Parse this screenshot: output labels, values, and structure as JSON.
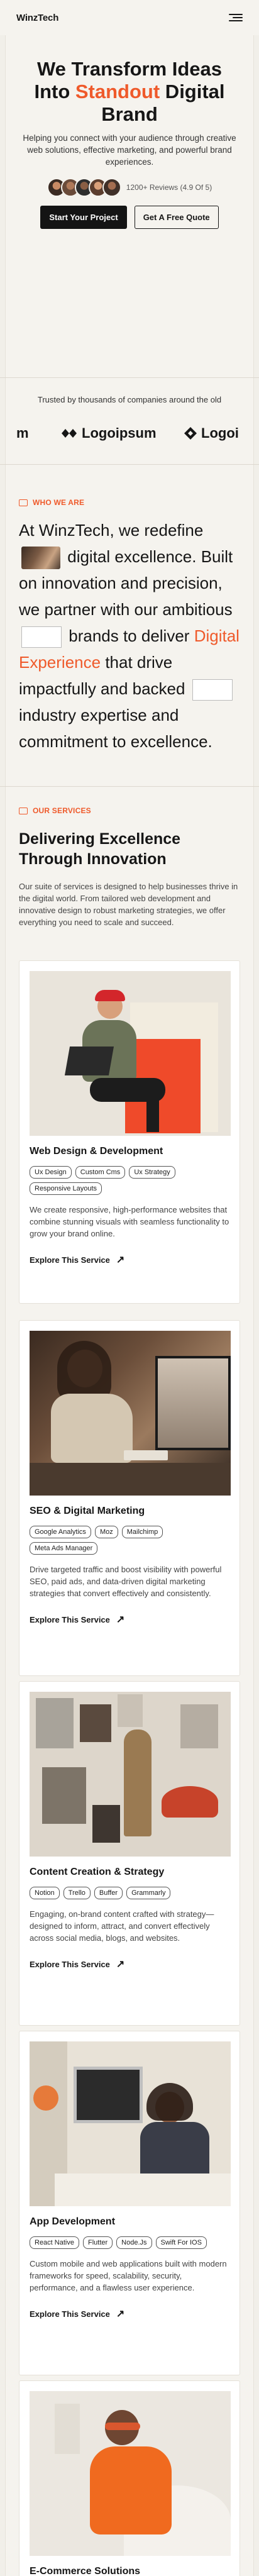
{
  "nav": {
    "brand": "WinzTech",
    "brand_mark": "W",
    "menu_icon": "hamburger-menu-icon"
  },
  "hero": {
    "title_line1": "We Transform Ideas",
    "title_line2_pre": "Into ",
    "title_accent": "Standout",
    "title_line2_post": " Digital",
    "title_line3": "Brand",
    "subtitle": "Helping you connect with your audience through creative web solutions, effective marketing, and powerful brand experiences.",
    "reviews": "1200+ Reviews (4.9 Of 5)",
    "primary_cta": "Start Your Project",
    "secondary_cta": "Get A Free Quote"
  },
  "trusted": {
    "text": "Trusted by thousands of companies around the old",
    "logos": [
      "m",
      "Logoipsum",
      "Logoi"
    ]
  },
  "about": {
    "eyebrow": "WHO WE ARE",
    "p1": "At WinzTech, we redefine",
    "p2": "digital excellence. Built on innovation and precision, we partner with our ambitious",
    "p3": "brands to deliver",
    "accent": "Digital Experience",
    "p4": "that drive impactfully and backed",
    "p5": "industry expertise and commitment to excellence."
  },
  "services": {
    "eyebrow": "OUR SERVICES",
    "title": "Delivering Excellence Through Innovation",
    "description": "Our suite of services is designed to help businesses thrive in the digital world. From tailored web development and innovative design to robust marketing strategies, we offer everything you need to scale and succeed.",
    "explore_label": "Explore This Service",
    "cards": [
      {
        "title": "Web Design & Development",
        "tags": [
          "Ux Design",
          "Custom Cms",
          "Ux Strategy",
          "Responsive Layouts"
        ],
        "desc": "We create responsive, high-performance websites that combine stunning visuals with seamless functionality to grow your brand online."
      },
      {
        "title": "SEO & Digital Marketing",
        "tags": [
          "Google Analytics",
          "Moz",
          "Mailchimp",
          "Meta Ads Manager"
        ],
        "desc": "Drive targeted traffic and boost visibility with powerful SEO, paid ads, and data-driven digital marketing strategies that convert effectively and consistently."
      },
      {
        "title": "Content Creation & Strategy",
        "tags": [
          "Notion",
          "Trello",
          "Buffer",
          "Grammarly"
        ],
        "desc": "Engaging, on-brand content crafted with strategy—designed to inform, attract, and convert effectively across social media, blogs, and websites."
      },
      {
        "title": "App Development",
        "tags": [
          "React Native",
          "Flutter",
          "Node.Js",
          "Swift For IOS"
        ],
        "desc": "Custom mobile and web applications built with modern frameworks for speed, scalability, security, performance, and a flawless user experience."
      },
      {
        "title": "E-Commerce Solutions",
        "tags": [],
        "desc": ""
      }
    ]
  },
  "colors": {
    "accent": "#ef5a2b",
    "dark": "#141414",
    "background": "#f5f3ee"
  }
}
